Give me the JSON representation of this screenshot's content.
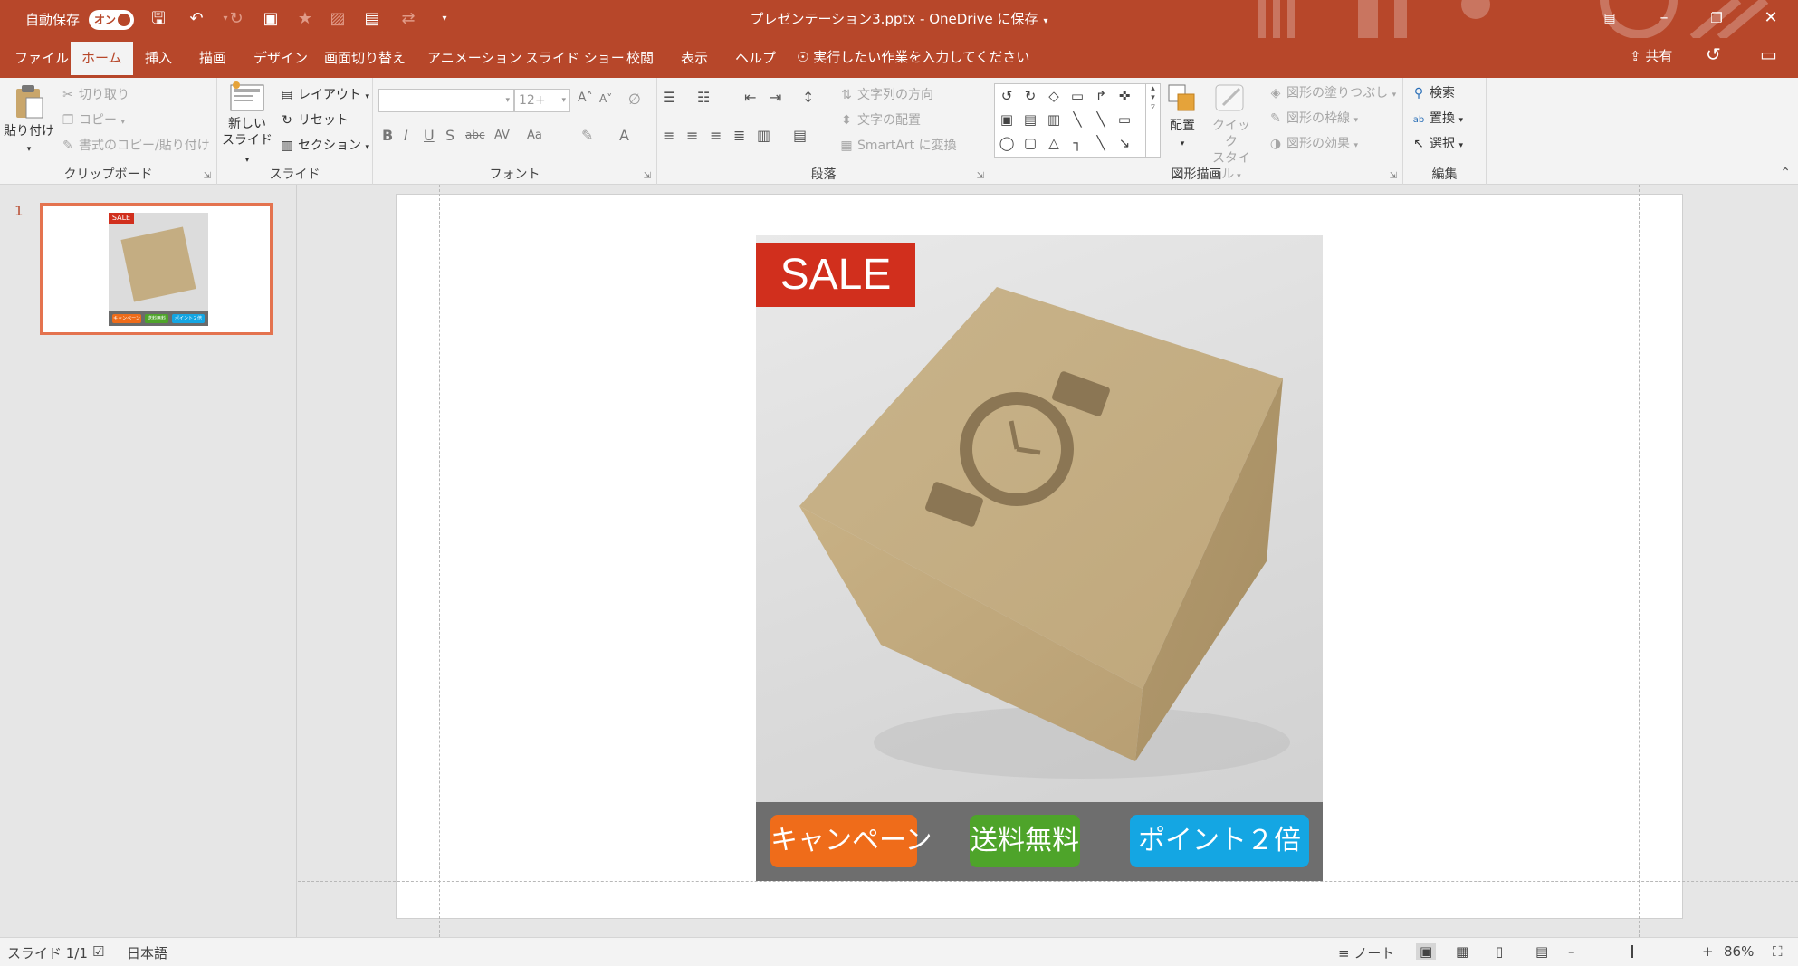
{
  "titlebar": {
    "autosave_label": "自動保存",
    "autosave_state": "オン",
    "doc_title": "プレゼンテーション3.pptx - OneDrive に保存",
    "accent": "#b7472a"
  },
  "tabs": [
    "ファイル",
    "ホーム",
    "挿入",
    "描画",
    "デザイン",
    "画面切り替え",
    "アニメーション",
    "スライド ショー",
    "校閲",
    "表示",
    "ヘルプ"
  ],
  "active_tab": "ホーム",
  "tell_me": "実行したい作業を入力してください",
  "share_label": "共有",
  "ribbon": {
    "clipboard": {
      "label": "クリップボード",
      "paste": "貼り付け",
      "cut": "切り取り",
      "copy": "コピー",
      "format_painter": "書式のコピー/貼り付け"
    },
    "slides": {
      "label": "スライド",
      "new_slide_1": "新しい",
      "new_slide_2": "スライド",
      "layout": "レイアウト",
      "reset": "リセット",
      "section": "セクション"
    },
    "font": {
      "label": "フォント",
      "size": "12+"
    },
    "paragraph": {
      "label": "段落",
      "text_direction": "文字列の方向",
      "align_text": "文字の配置",
      "smartart": "SmartArt に変換"
    },
    "drawing": {
      "label": "図形描画",
      "arrange": "配置",
      "quick_styles_1": "クイック",
      "quick_styles_2": "スタイル",
      "shape_fill": "図形の塗りつぶし",
      "shape_outline": "図形の枠線",
      "shape_effects": "図形の効果"
    },
    "editing": {
      "label": "編集",
      "find": "検索",
      "replace": "置換",
      "select": "選択"
    }
  },
  "thumbnails": [
    {
      "number": "1"
    }
  ],
  "slide": {
    "sale": "SALE",
    "buttons": [
      {
        "label": "キャンペーン",
        "color": "#ef6c1a"
      },
      {
        "label": "送料無料",
        "color": "#4ea42a"
      },
      {
        "label": "ポイント２倍",
        "color": "#14a6e3"
      }
    ],
    "sale_color": "#d12f1d",
    "box_color": "#c4ad82"
  },
  "statusbar": {
    "slide_info": "スライド 1/1",
    "language": "日本語",
    "notes": "ノート",
    "zoom": "86%"
  }
}
